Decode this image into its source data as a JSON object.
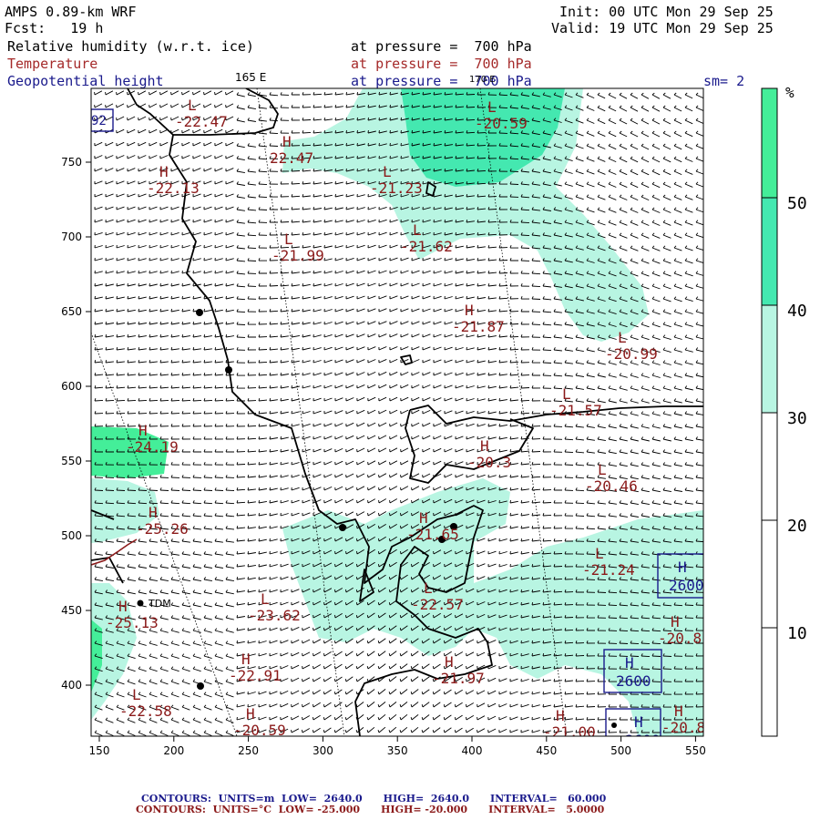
{
  "header": {
    "model": "AMPS 0.89-km WRF",
    "fcst": "Fcst:   19 h",
    "init": "Init: 00 UTC Mon 29 Sep 25",
    "valid": "Valid: 19 UTC Mon 29 Sep 25",
    "field1_name": "Relative humidity (w.r.t. ice)",
    "field1_level": "at pressure =  700 hPa",
    "field2_name": "Temperature",
    "field2_level": "at pressure =  700 hPa",
    "field3_name": "Geopotential height",
    "field3_level": "at pressure =  700 hPa",
    "sm": "sm= 2"
  },
  "map": {
    "lon_label_1": "165 E",
    "lon_label_2": "170 E",
    "x_ticks": [
      "150",
      "200",
      "250",
      "300",
      "350",
      "400",
      "450",
      "500",
      "550"
    ],
    "y_ticks": [
      "750",
      "700",
      "650",
      "600",
      "550",
      "500",
      "450",
      "400"
    ],
    "station_label": "TDM",
    "temp_labels": [
      "-22.47",
      "22.47",
      "-20.59",
      "-22.13",
      "-21.23",
      "-21.62",
      "-21.99",
      "-21.87",
      "-20.99",
      "-21.57",
      "-24.19",
      "-20.3",
      "-20.46",
      "-25.26",
      "-21.65",
      "-21.24",
      "-22.57",
      "-23.62",
      "-25.13",
      "-20.8",
      "-22.91",
      "-21.97",
      "-22.58",
      "-20.59",
      "-21.00",
      "-20.8"
    ],
    "temp_letters": [
      "L",
      "H",
      "L",
      "H",
      "L",
      "L",
      "L",
      "H",
      "L",
      "L",
      "H",
      "H",
      "L",
      "H",
      "H",
      "L",
      "L",
      "L",
      "H",
      "H",
      "H",
      "H",
      "L",
      "H",
      "H",
      "H"
    ],
    "height_labels": [
      "2600",
      "2600",
      "2600"
    ],
    "height_letters": [
      "H",
      "H",
      "H"
    ],
    "edge_label": "92"
  },
  "colorbar": {
    "unit": "%",
    "ticks": [
      "50",
      "40",
      "30",
      "20",
      "10"
    ],
    "colors": [
      "#44ee99",
      "#44e8b0",
      "#b8f5e2",
      "#ffffff",
      "#ffffff",
      "#ffffff"
    ]
  },
  "footer": {
    "line1_label": "CONTOURS:",
    "line1_units": "UNITS=m",
    "line1_low": "LOW=  2640.0",
    "line1_high": "HIGH=  2640.0",
    "line1_interval": "INTERVAL=   60.000",
    "line2_label": "CONTOURS:",
    "line2_units": "UNITS=°C",
    "line2_low": "LOW= -25.000",
    "line2_high": "HIGH= -20.000",
    "line2_interval": "INTERVAL=   5.0000"
  }
}
